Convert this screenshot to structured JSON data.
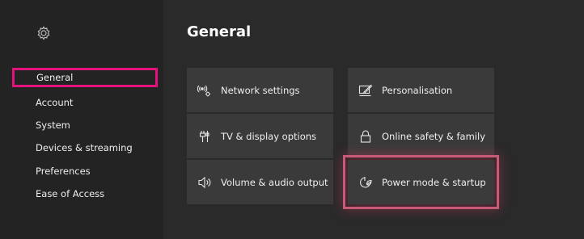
{
  "sidebar": {
    "items": [
      {
        "label": "General",
        "selected": true
      },
      {
        "label": "Account"
      },
      {
        "label": "System"
      },
      {
        "label": "Devices & streaming"
      },
      {
        "label": "Preferences"
      },
      {
        "label": "Ease of Access"
      }
    ]
  },
  "main": {
    "title": "General",
    "tiles": [
      {
        "label": "Network settings",
        "icon": "network-icon"
      },
      {
        "label": "Personalisation",
        "icon": "personalisation-icon"
      },
      {
        "label": "TV & display options",
        "icon": "tv-display-icon"
      },
      {
        "label": "Online safety & family",
        "icon": "lock-icon"
      },
      {
        "label": "Volume & audio output",
        "icon": "speaker-icon"
      },
      {
        "label": "Power mode & startup",
        "icon": "power-icon",
        "focused": true
      }
    ]
  },
  "colors": {
    "selection_border": "#e5127d",
    "focus_glow": "#c75a77"
  }
}
